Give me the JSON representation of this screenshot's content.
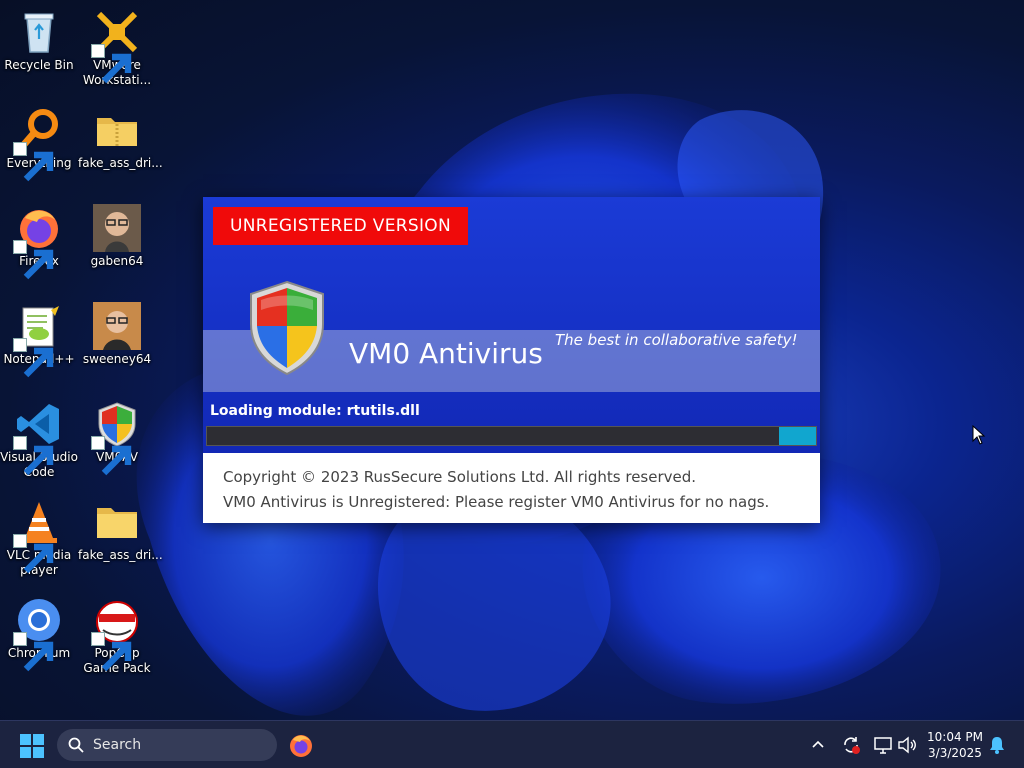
{
  "desktop": {
    "icons": [
      {
        "label": "Recycle Bin",
        "icon": "recycle-bin-icon"
      },
      {
        "label": "VMware Workstati...",
        "icon": "vmware-icon"
      },
      {
        "label": "Everything",
        "icon": "everything-search-icon"
      },
      {
        "label": "fake_ass_dri...",
        "icon": "zip-folder-icon"
      },
      {
        "label": "Firefox",
        "icon": "firefox-icon"
      },
      {
        "label": "gaben64",
        "icon": "user-photo-icon"
      },
      {
        "label": "Notepad++",
        "icon": "notepadpp-icon"
      },
      {
        "label": "sweeney64",
        "icon": "user-photo-icon"
      },
      {
        "label": "Visual Studio Code",
        "icon": "vscode-icon"
      },
      {
        "label": "VM0AV",
        "icon": "shield-icon"
      },
      {
        "label": "VLC media player",
        "icon": "vlc-icon"
      },
      {
        "label": "fake_ass_dri...",
        "icon": "folder-icon"
      },
      {
        "label": "Chromium",
        "icon": "chromium-icon"
      },
      {
        "label": "PopCap Game Pack",
        "icon": "popcap-icon"
      }
    ]
  },
  "splash": {
    "badge": "UNREGISTERED VERSION",
    "product_name": "VM0 Antivirus",
    "tagline": "The best in collaborative safety!",
    "loading_text": "Loading module: rtutils.dll",
    "progress_fraction": 0.06,
    "copyright": "Copyright © 2023 RusSecure Solutions Ltd. All rights reserved.",
    "nag": "VM0 Antivirus is Unregistered: Please register VM0 Antivirus for no nags.",
    "colors": {
      "badge": "#f00a0a",
      "panel": "#1530c4",
      "progress": "#11a6cf"
    }
  },
  "taskbar": {
    "search_placeholder": "Search",
    "time": "10:04 PM",
    "date": "3/3/2025"
  }
}
